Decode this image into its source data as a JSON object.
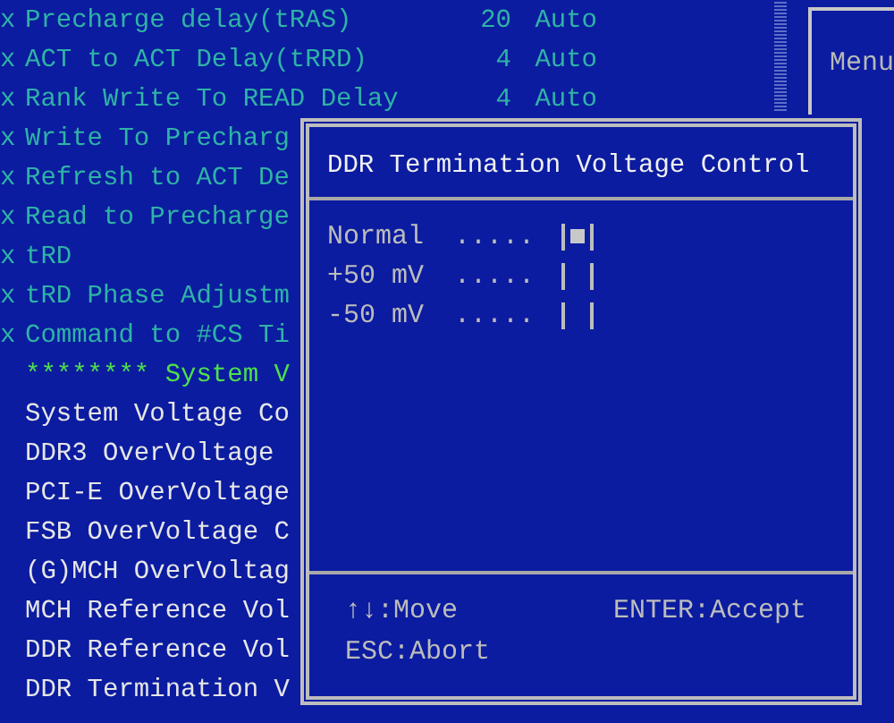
{
  "settings": [
    {
      "kind": "disabled",
      "marker": "x",
      "label": "Precharge delay(tRAS)",
      "value": "20",
      "mode": "Auto"
    },
    {
      "kind": "disabled",
      "marker": "x",
      "label": "ACT to ACT Delay(tRRD)",
      "value": "4",
      "mode": "Auto"
    },
    {
      "kind": "disabled",
      "marker": "x",
      "label": "Rank Write To READ Delay",
      "value": "4",
      "mode": "Auto"
    },
    {
      "kind": "disabled",
      "marker": "x",
      "label": "Write To Precharg"
    },
    {
      "kind": "disabled",
      "marker": "x",
      "label": "Refresh to ACT De"
    },
    {
      "kind": "disabled",
      "marker": "x",
      "label": "Read to Precharge"
    },
    {
      "kind": "disabled",
      "marker": "x",
      "label": "tRD"
    },
    {
      "kind": "disabled",
      "marker": "x",
      "label": "tRD Phase Adjustm"
    },
    {
      "kind": "disabled",
      "marker": "x",
      "label": "Command to #CS Ti"
    },
    {
      "kind": "header",
      "label": "******** System V"
    },
    {
      "kind": "item",
      "label": "System Voltage Co"
    },
    {
      "kind": "item",
      "label": "DDR3 OverVoltage"
    },
    {
      "kind": "item",
      "label": "PCI-E OverVoltage"
    },
    {
      "kind": "item",
      "label": "FSB OverVoltage C"
    },
    {
      "kind": "item",
      "label": "(G)MCH OverVoltag"
    },
    {
      "kind": "item",
      "label": "MCH Reference Vol"
    },
    {
      "kind": "item",
      "label": "DDR Reference Vol"
    },
    {
      "kind": "item",
      "label": "DDR Termination V"
    }
  ],
  "help_panel": {
    "title": "Menu"
  },
  "dialog": {
    "title": "DDR Termination Voltage Control",
    "options": [
      {
        "label": "Normal",
        "leader": ".....",
        "selected": true
      },
      {
        "label": "+50 mV",
        "leader": ".....",
        "selected": false
      },
      {
        "label": "-50 mV",
        "leader": ".....",
        "selected": false
      }
    ],
    "hints": [
      {
        "key": "↑↓",
        "action": ":Move"
      },
      {
        "key": "ENTER",
        "action": ":Accept"
      },
      {
        "key": "ESC",
        "action": ":Abort"
      }
    ]
  }
}
